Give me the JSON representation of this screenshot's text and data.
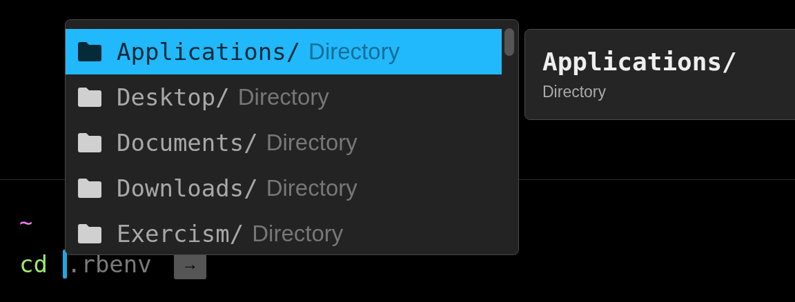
{
  "prompt": {
    "directory": "~",
    "command": "cd",
    "suggestion": ".rbenv",
    "accept_key": "→"
  },
  "completions": [
    {
      "name": "Applications/",
      "description": "Directory",
      "selected": true
    },
    {
      "name": "Desktop/",
      "description": "Directory",
      "selected": false
    },
    {
      "name": "Documents/",
      "description": "Directory",
      "selected": false
    },
    {
      "name": "Downloads/",
      "description": "Directory",
      "selected": false
    },
    {
      "name": "Exercism/",
      "description": "Directory",
      "selected": false
    }
  ],
  "detail": {
    "title": "Applications/",
    "description": "Directory"
  }
}
